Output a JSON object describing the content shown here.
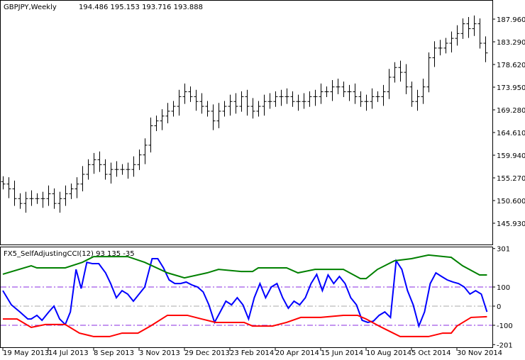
{
  "main_chart": {
    "symbol_label": "GBPJPY,Weekly",
    "ohlc_label": "194.486 195.153 193.716 193.888",
    "price_ticks": [
      "187.960",
      "183.290",
      "178.620",
      "173.950",
      "169.280",
      "164.610",
      "159.940",
      "155.270",
      "150.600",
      "145.930"
    ],
    "bar_color": "#000000"
  },
  "indicator": {
    "label": "FX5_SelfAdjustingCCI(12) 93 135 -35",
    "ticks": [
      "301",
      "100",
      "0",
      "-100",
      "-201"
    ],
    "colors": {
      "cci": "#0000ff",
      "upper": "#008000",
      "lower": "#ff0000",
      "level": "#8a2be2"
    }
  },
  "time_axis": {
    "labels": [
      "19 May 2013",
      "14 Jul 2013",
      "8 Sep 2013",
      "3 Nov 2013",
      "29 Dec 2013",
      "23 Feb 2014",
      "20 Apr 2014",
      "15 Jun 2014",
      "10 Aug 2014",
      "5 Oct 2014",
      "30 Nov 2014"
    ]
  },
  "chart_data": [
    {
      "type": "candlestick-bars",
      "title": "GBPJPY,Weekly",
      "ylim": [
        143.5,
        191.9
      ],
      "closes": [
        154,
        153,
        151,
        150,
        151,
        151,
        151,
        151,
        152,
        150,
        151,
        152,
        153,
        154,
        156,
        158,
        159,
        158,
        156,
        157,
        157,
        157,
        157,
        158,
        160,
        162,
        166,
        167,
        168,
        169,
        170,
        172,
        173,
        172,
        171,
        170,
        169,
        167,
        169,
        170,
        171,
        170,
        172,
        170,
        169,
        170,
        171,
        171,
        172,
        172,
        172,
        171,
        171,
        171,
        172,
        172,
        173,
        173,
        174,
        174,
        173,
        173,
        172,
        171,
        171,
        172,
        172,
        173,
        176,
        178,
        177,
        174,
        171,
        172,
        174,
        180,
        182,
        182,
        183,
        184,
        185,
        187,
        186,
        187,
        183,
        181
      ]
    },
    {
      "type": "line",
      "title": "FX5_SelfAdjustingCCI(12)",
      "ylim": [
        -201,
        301
      ],
      "levels": [
        100,
        0,
        -100
      ],
      "series": [
        {
          "name": "cci",
          "points": [
            [
              0,
              81
            ],
            [
              1.5,
              7
            ],
            [
              3,
              -30
            ],
            [
              4.4,
              -67
            ],
            [
              5,
              -67
            ],
            [
              6,
              -48
            ],
            [
              6.9,
              -74
            ],
            [
              8.1,
              -30
            ],
            [
              9,
              0
            ],
            [
              10,
              -67
            ],
            [
              11,
              -96
            ],
            [
              11.9,
              -30
            ],
            [
              12.9,
              192
            ],
            [
              13.8,
              92
            ],
            [
              14.8,
              229
            ],
            [
              15.8,
              222
            ],
            [
              16.9,
              222
            ],
            [
              18.1,
              174
            ],
            [
              19,
              118
            ],
            [
              20,
              44
            ],
            [
              21,
              81
            ],
            [
              22,
              63
            ],
            [
              23,
              26
            ],
            [
              24,
              63
            ],
            [
              25,
              100
            ],
            [
              26.3,
              248
            ],
            [
              27.3,
              248
            ],
            [
              28.3,
              200
            ],
            [
              29.3,
              137
            ],
            [
              30.3,
              118
            ],
            [
              31.3,
              118
            ],
            [
              32.3,
              126
            ],
            [
              33.3,
              111
            ],
            [
              34.3,
              100
            ],
            [
              35.3,
              74
            ],
            [
              36.3,
              7
            ],
            [
              37.3,
              -85
            ],
            [
              38.3,
              -30
            ],
            [
              39.3,
              26
            ],
            [
              40.3,
              7
            ],
            [
              41.3,
              44
            ],
            [
              42.3,
              7
            ],
            [
              43.3,
              -67
            ],
            [
              44.3,
              44
            ],
            [
              45.3,
              118
            ],
            [
              46.3,
              44
            ],
            [
              47.3,
              100
            ],
            [
              48.3,
              118
            ],
            [
              49.3,
              44
            ],
            [
              50.3,
              -11
            ],
            [
              51.3,
              26
            ],
            [
              52.3,
              7
            ],
            [
              53.3,
              44
            ],
            [
              54.3,
              118
            ],
            [
              55.3,
              166
            ],
            [
              56.3,
              81
            ],
            [
              57.3,
              163
            ],
            [
              58.3,
              118
            ],
            [
              59.3,
              155
            ],
            [
              60.3,
              118
            ],
            [
              61.3,
              44
            ],
            [
              62.3,
              7
            ],
            [
              63.3,
              -74
            ],
            [
              64.3,
              -85
            ],
            [
              65.3,
              -78
            ],
            [
              66.3,
              -48
            ],
            [
              67.3,
              -30
            ],
            [
              68.3,
              -59
            ],
            [
              69.3,
              237
            ],
            [
              70.3,
              192
            ],
            [
              71.3,
              81
            ],
            [
              72.3,
              7
            ],
            [
              73.3,
              -104
            ],
            [
              74.3,
              -30
            ],
            [
              75.3,
              118
            ],
            [
              76.3,
              174
            ],
            [
              77.3,
              155
            ],
            [
              78.3,
              137
            ],
            [
              79.3,
              126
            ],
            [
              80.3,
              118
            ],
            [
              81.3,
              100
            ],
            [
              82.3,
              63
            ],
            [
              83.3,
              81
            ],
            [
              84.3,
              63
            ],
            [
              85.3,
              -30
            ]
          ]
        },
        {
          "name": "upper",
          "points": [
            [
              0,
              167
            ],
            [
              5,
              211
            ],
            [
              6,
              200
            ],
            [
              11,
              200
            ],
            [
              14,
              229
            ],
            [
              16,
              259
            ],
            [
              22,
              259
            ],
            [
              25,
              229
            ],
            [
              29,
              174
            ],
            [
              32,
              148
            ],
            [
              36,
              174
            ],
            [
              38,
              192
            ],
            [
              42,
              181
            ],
            [
              44,
              181
            ],
            [
              45,
              200
            ],
            [
              50,
              200
            ],
            [
              52,
              174
            ],
            [
              55,
              192
            ],
            [
              60,
              192
            ],
            [
              63,
              144
            ],
            [
              64,
              144
            ],
            [
              66,
              192
            ],
            [
              69,
              237
            ],
            [
              72,
              248
            ],
            [
              75,
              267
            ],
            [
              79,
              255
            ],
            [
              81,
              211
            ],
            [
              84,
              163
            ],
            [
              85.3,
              163
            ]
          ]
        },
        {
          "name": "lower",
          "points": [
            [
              0,
              -67
            ],
            [
              2.5,
              -67
            ],
            [
              5,
              -111
            ],
            [
              7.5,
              -96
            ],
            [
              11,
              -96
            ],
            [
              13.5,
              -141
            ],
            [
              16,
              -159
            ],
            [
              18.8,
              -159
            ],
            [
              21,
              -141
            ],
            [
              23.8,
              -141
            ],
            [
              26,
              -104
            ],
            [
              29,
              -48
            ],
            [
              32.5,
              -48
            ],
            [
              35,
              -67
            ],
            [
              37.5,
              -85
            ],
            [
              42.5,
              -85
            ],
            [
              44,
              -104
            ],
            [
              47.5,
              -104
            ],
            [
              50,
              -85
            ],
            [
              52.5,
              -59
            ],
            [
              56,
              -59
            ],
            [
              60,
              -48
            ],
            [
              62.5,
              -48
            ],
            [
              64,
              -67
            ],
            [
              66.3,
              -104
            ],
            [
              67.5,
              -122
            ],
            [
              70,
              -159
            ],
            [
              75,
              -159
            ],
            [
              77.5,
              -141
            ],
            [
              79,
              -141
            ],
            [
              80,
              -104
            ],
            [
              82.5,
              -59
            ],
            [
              85.3,
              -55
            ]
          ]
        }
      ]
    }
  ]
}
